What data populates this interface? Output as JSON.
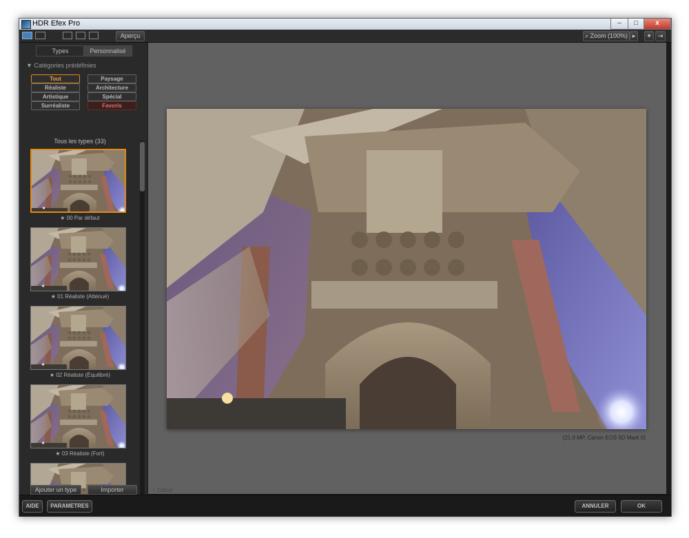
{
  "window": {
    "title": "HDR Efex Pro",
    "controls": {
      "minimize": "–",
      "maximize": "□",
      "close": "x"
    }
  },
  "toolbar": {
    "preview_label": "Aperçu",
    "zoom_label": "Zoom (100%)"
  },
  "sidebar": {
    "tabs": [
      "Types",
      "Personnalisé"
    ],
    "category_header": "Catégories prédéfinies",
    "categories": [
      "Tout",
      "Paysage",
      "Réaliste",
      "Architecture",
      "Artistique",
      "Spécial",
      "Surréaliste",
      "Favoris"
    ],
    "list_title": "Tous les types (33)",
    "presets": [
      "★ 00 Par défaut",
      "★ 01 Réaliste (Atténué)",
      "★ 02 Réaliste (Équilibré)",
      "★ 03 Réaliste (Fort)"
    ],
    "add_button": "Ajouter un type",
    "import_button": "Importer"
  },
  "main": {
    "photo_info": "(21.0 MP, Canon EOS 5D Mark II)",
    "status": "Calcul"
  },
  "footer": {
    "help": "AIDE",
    "settings": "PARAMETRES",
    "cancel": "ANNULER",
    "ok": "OK"
  },
  "colors": {
    "selected_border": "#e38a1a",
    "favoris": "#e07070",
    "canvas": "#616161"
  }
}
